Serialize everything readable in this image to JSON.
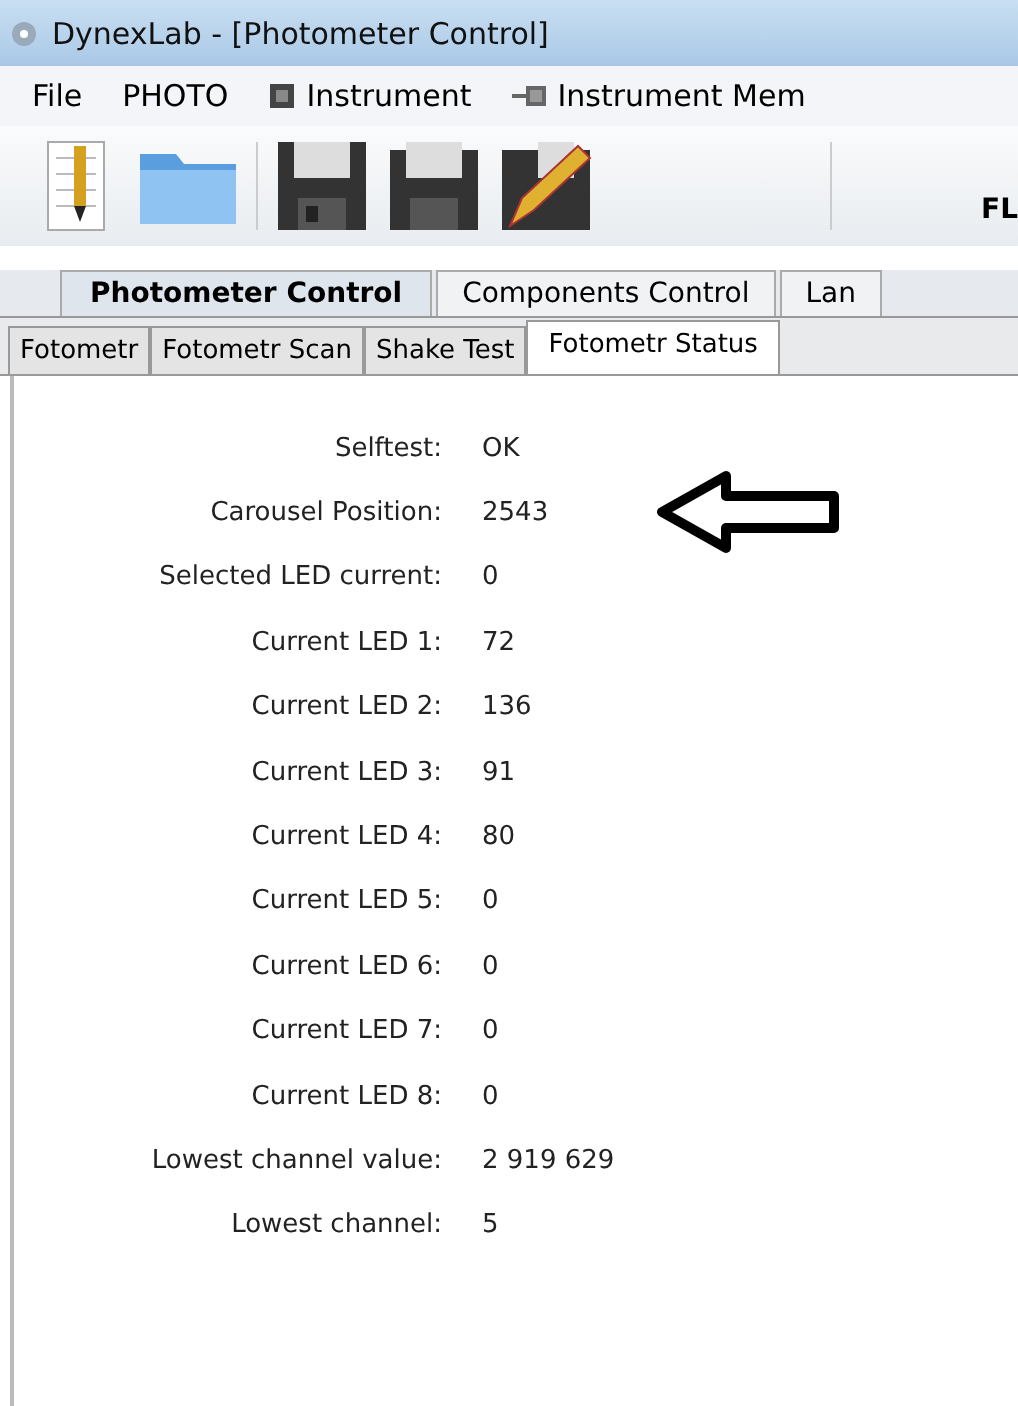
{
  "window": {
    "title": "DynexLab - [Photometer Control]"
  },
  "menu": [
    {
      "label": "File",
      "kind": "plain"
    },
    {
      "label": "PHOTO",
      "kind": "plain"
    },
    {
      "label": "Instrument",
      "kind": "chip"
    },
    {
      "label": "Instrument Mem",
      "kind": "plug"
    }
  ],
  "toolbar": {
    "right_label": "FL"
  },
  "tabs": [
    {
      "label": "Photometer Control",
      "selected": true
    },
    {
      "label": "Components Control",
      "selected": false
    },
    {
      "label": "Lan",
      "selected": false
    }
  ],
  "subtabs": [
    {
      "label": "Fotometr",
      "selected": false
    },
    {
      "label": "Fotometr Scan",
      "selected": false
    },
    {
      "label": "Shake Test",
      "selected": false
    },
    {
      "label": "Fotometr Status",
      "selected": true
    }
  ],
  "fields": [
    {
      "label": "Selftest:",
      "value": "OK",
      "arrow": false
    },
    {
      "label": "Carousel Position:",
      "value": "2543",
      "arrow": true
    },
    {
      "label": "Selected LED current:",
      "value": "0",
      "arrow": false
    },
    {
      "label": "Current LED 1:",
      "value": "72",
      "arrow": false
    },
    {
      "label": "Current LED 2:",
      "value": "136",
      "arrow": false
    },
    {
      "label": "Current LED 3:",
      "value": "91",
      "arrow": false
    },
    {
      "label": "Current LED 4:",
      "value": "80",
      "arrow": false
    },
    {
      "label": "Current LED 5:",
      "value": "0",
      "arrow": false
    },
    {
      "label": "Current LED 6:",
      "value": "0",
      "arrow": false
    },
    {
      "label": "Current LED 7:",
      "value": "0",
      "arrow": false
    },
    {
      "label": "Current LED 8:",
      "value": "0",
      "arrow": false
    },
    {
      "label": "Lowest channel value:",
      "value": "2 919 629",
      "arrow": false
    },
    {
      "label": "Lowest channel:",
      "value": "5",
      "arrow": false
    }
  ]
}
